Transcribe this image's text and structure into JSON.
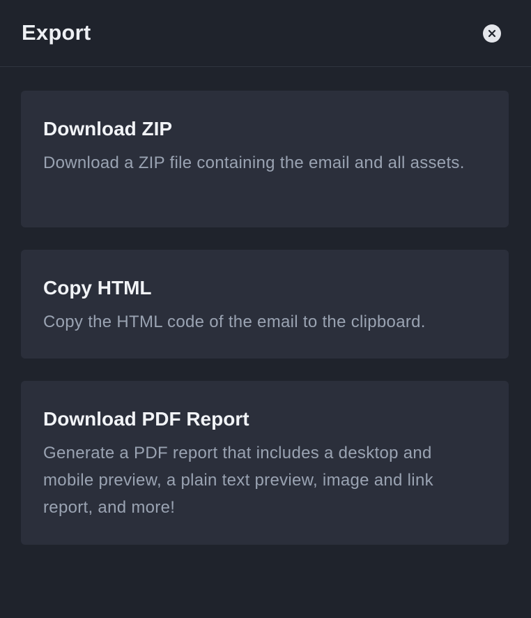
{
  "header": {
    "title": "Export"
  },
  "options": [
    {
      "title": "Download ZIP",
      "description": "Download a ZIP file containing the email and all assets."
    },
    {
      "title": "Copy HTML",
      "description": "Copy the HTML code of the email to the clipboard."
    },
    {
      "title": "Download PDF Report",
      "description": "Generate a PDF report that includes a desktop and mobile preview, a plain text preview, image and link report, and more!"
    }
  ],
  "colors": {
    "background": "#1f232c",
    "card": "#2b2f3b",
    "title_text": "#f1f3f6",
    "description_text": "#9aa3b2",
    "close_button": "#e4e6eb"
  },
  "icons": {
    "close": "close-icon"
  }
}
